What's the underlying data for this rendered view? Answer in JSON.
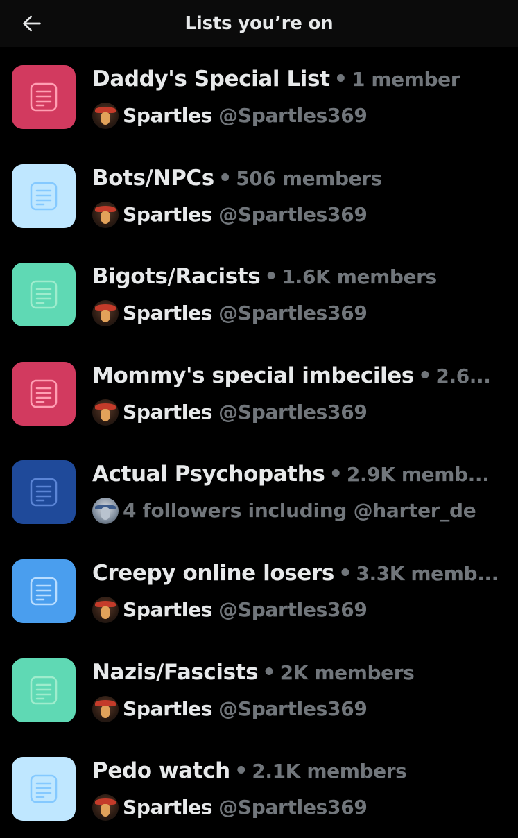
{
  "header": {
    "title": "Lists you’re on",
    "back_icon": "arrow-left-icon"
  },
  "colors": {
    "background": "#000000",
    "header_bg": "#0b0b0b",
    "text_primary": "#e7e9ea",
    "text_secondary": "#71767b"
  },
  "lists": [
    {
      "name": "Daddy's Special List",
      "members": "1 member",
      "tile_color": "#d23a5f",
      "icon_color": "#ff9fb3",
      "owner_type": "owner",
      "owner_name": "Spartles",
      "owner_handle": "@Spartles369"
    },
    {
      "name": "Bots/NPCs",
      "members": "506 members",
      "tile_color": "#bfe7ff",
      "icon_color": "#84c9ff",
      "owner_type": "owner",
      "owner_name": "Spartles",
      "owner_handle": "@Spartles369"
    },
    {
      "name": "Bigots/Racists",
      "members": "1.6K members",
      "tile_color": "#5fd9b4",
      "icon_color": "#9feccd",
      "owner_type": "owner",
      "owner_name": "Spartles",
      "owner_handle": "@Spartles369"
    },
    {
      "name": "Mommy's special imbeciles",
      "members": "2.6...",
      "tile_color": "#d23a5f",
      "icon_color": "#ff9fb3",
      "owner_type": "owner",
      "owner_name": "Spartles",
      "owner_handle": "@Spartles369"
    },
    {
      "name": "Actual Psychopaths",
      "members": "2.9K memb...",
      "tile_color": "#1f4a9a",
      "icon_color": "#5b85d6",
      "owner_type": "followers",
      "followers_text": "4 followers including @harter_de"
    },
    {
      "name": "Creepy online losers",
      "members": "3.3K memb...",
      "tile_color": "#4a9eee",
      "icon_color": "#b9ddff",
      "owner_type": "owner",
      "owner_name": "Spartles",
      "owner_handle": "@Spartles369"
    },
    {
      "name": "Nazis/Fascists",
      "members": "2K members",
      "tile_color": "#5fd9b4",
      "icon_color": "#9feccd",
      "owner_type": "owner",
      "owner_name": "Spartles",
      "owner_handle": "@Spartles369"
    },
    {
      "name": "Pedo watch",
      "members": "2.1K members",
      "tile_color": "#bfe7ff",
      "icon_color": "#84c9ff",
      "owner_type": "owner",
      "owner_name": "Spartles",
      "owner_handle": "@Spartles369"
    }
  ]
}
